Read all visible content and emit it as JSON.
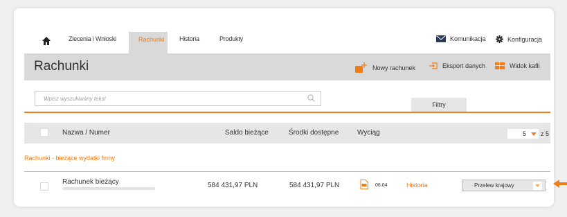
{
  "nav": {
    "home_icon": "home-icon",
    "items": [
      {
        "label": "Zlecenia i Wnioski"
      },
      {
        "label": "Rachunki",
        "active": true
      },
      {
        "label": "Historia"
      },
      {
        "label": "Produkty"
      }
    ],
    "right": [
      {
        "label": "Komunikacja",
        "icon": "envelope-icon"
      },
      {
        "label": "Konfiguracja",
        "icon": "gear-icon"
      }
    ]
  },
  "header": {
    "title": "Rachunki",
    "actions": [
      {
        "label": "Nowy rachunek",
        "icon": "new-account-icon"
      },
      {
        "label": "Eksport danych",
        "icon": "export-icon"
      },
      {
        "label": "Widok kafli",
        "icon": "tiles-icon"
      }
    ]
  },
  "search": {
    "placeholder": "Wpisz wyszukiwany tekst",
    "value": ""
  },
  "filters_label": "Filtry",
  "table": {
    "columns": [
      "Nazwa / Numer",
      "Saldo bieżące",
      "Środki dostępne",
      "Wyciąg"
    ],
    "page_size": "5",
    "page_of": "z 5"
  },
  "section_title": "Rachunki - bieżące wydatki firmy",
  "rows": [
    {
      "name": "Rachunek bieżący",
      "saldo": "584 431,97 PLN",
      "dostepne": "584 431,97 PLN",
      "statement_date": "06.04",
      "history_link": "Historia",
      "transfer_select": "Przelew krajowy"
    }
  ],
  "colors": {
    "accent": "#f07d18",
    "band": "#d9d9d9",
    "header_row": "#e6e6e6"
  }
}
